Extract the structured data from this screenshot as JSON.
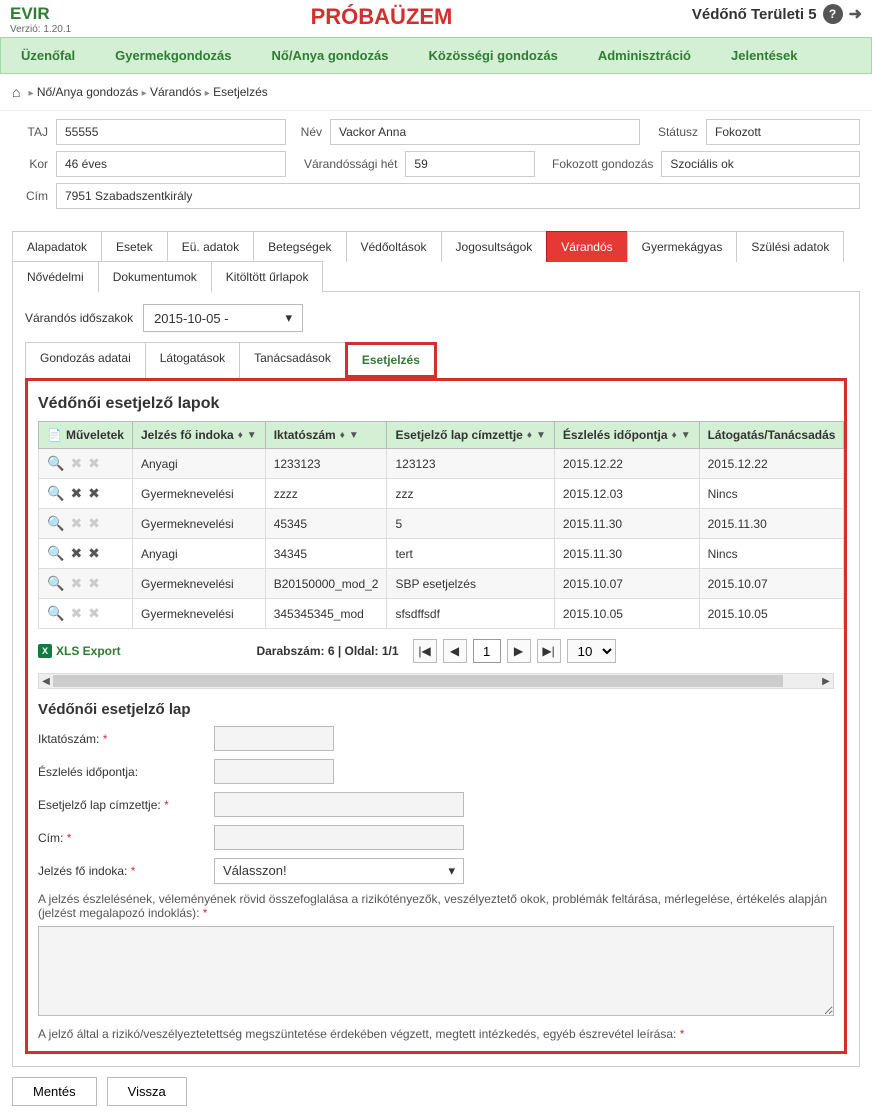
{
  "app": {
    "title": "EVIR",
    "version": "Verzió: 1.20.1",
    "banner": "PRÓBAÜZEM",
    "user": "Védőnő Területi 5",
    "help": "?",
    "logout": "➜"
  },
  "nav": {
    "items": [
      "Üzenőfal",
      "Gyermekgondozás",
      "Nő/Anya gondozás",
      "Közösségi gondozás",
      "Adminisztráció",
      "Jelentések"
    ]
  },
  "breadcrumb": {
    "home": "⌂",
    "items": [
      "Nő/Anya gondozás",
      "Várandós",
      "Esetjelzés"
    ]
  },
  "info": {
    "taj_label": "TAJ",
    "taj": "55555",
    "nev_label": "Név",
    "nev": "Vackor Anna",
    "statusz_label": "Státusz",
    "statusz": "Fokozott",
    "kor_label": "Kor",
    "kor": "46 éves",
    "vhet_label": "Várandóssági hét",
    "vhet": "59",
    "fokg_label": "Fokozott gondozás",
    "fokg": "Szociális ok",
    "cim_label": "Cím",
    "cim": "7951 Szabadszentkirály"
  },
  "tabs": [
    "Alapadatok",
    "Esetek",
    "Eü. adatok",
    "Betegségek",
    "Védőoltások",
    "Jogosultságok",
    "Várandós",
    "Gyermekágyas",
    "Szülési adatok",
    "Nővédelmi",
    "Dokumentumok",
    "Kitöltött űrlapok"
  ],
  "period": {
    "label": "Várandós időszakok",
    "value": "2015-10-05 -"
  },
  "subtabs": [
    "Gondozás adatai",
    "Látogatások",
    "Tanácsadások",
    "Esetjelzés"
  ],
  "grid": {
    "title": "Védőnői esetjelző lapok",
    "headers": {
      "ops": "Műveletek",
      "indok": "Jelzés fő indoka",
      "iktato": "Iktatószám",
      "cimzett": "Esetjelző lap címzettje",
      "eszleles": "Észlelés időpontja",
      "latogatas": "Látogatás/Tanácsadás"
    },
    "rows": [
      {
        "indok": "Anyagi",
        "iktato": "1233123",
        "cimzett": "123123",
        "eszleles": "2015.12.22",
        "latogatas": "2015.12.22",
        "del": false
      },
      {
        "indok": "Gyermeknevelési",
        "iktato": "zzzz",
        "cimzett": "zzz",
        "eszleles": "2015.12.03",
        "latogatas": "Nincs",
        "del": true
      },
      {
        "indok": "Gyermeknevelési",
        "iktato": "45345",
        "cimzett": "5",
        "eszleles": "2015.11.30",
        "latogatas": "2015.11.30",
        "del": false
      },
      {
        "indok": "Anyagi",
        "iktato": "34345",
        "cimzett": "tert",
        "eszleles": "2015.11.30",
        "latogatas": "Nincs",
        "del": true
      },
      {
        "indok": "Gyermeknevelési",
        "iktato": "B20150000_mod_2",
        "cimzett": "SBP esetjelzés",
        "eszleles": "2015.10.07",
        "latogatas": "2015.10.07",
        "del": false
      },
      {
        "indok": "Gyermeknevelési",
        "iktato": "345345345_mod",
        "cimzett": "sfsdffsdf",
        "eszleles": "2015.10.05",
        "latogatas": "2015.10.05",
        "del": false
      }
    ],
    "export": "XLS Export",
    "pager_info": "Darabszám: 6 | Oldal: 1/1",
    "page": "1",
    "page_size": "10"
  },
  "form": {
    "title": "Védőnői esetjelző lap",
    "iktato_label": "Iktatószám:",
    "eszleles_label": "Észlelés időpontja:",
    "cimzett_label": "Esetjelző lap címzettje:",
    "cim_label": "Cím:",
    "indok_label": "Jelzés fő indoka:",
    "indok_placeholder": "Válasszon!",
    "desc1": "A jelzés észlelésének, véleményének rövid összefoglalása a rizikótényezők, veszélyeztető okok, problémák feltárása, mérlegelése, értékelés alapján (jelzést megalapozó indoklás):",
    "desc2": "A jelző által a rizikó/veszélyeztetettség megszüntetése érdekében végzett, megtett intézkedés, egyéb észrevétel leírása:"
  },
  "buttons": {
    "save": "Mentés",
    "back": "Vissza"
  }
}
